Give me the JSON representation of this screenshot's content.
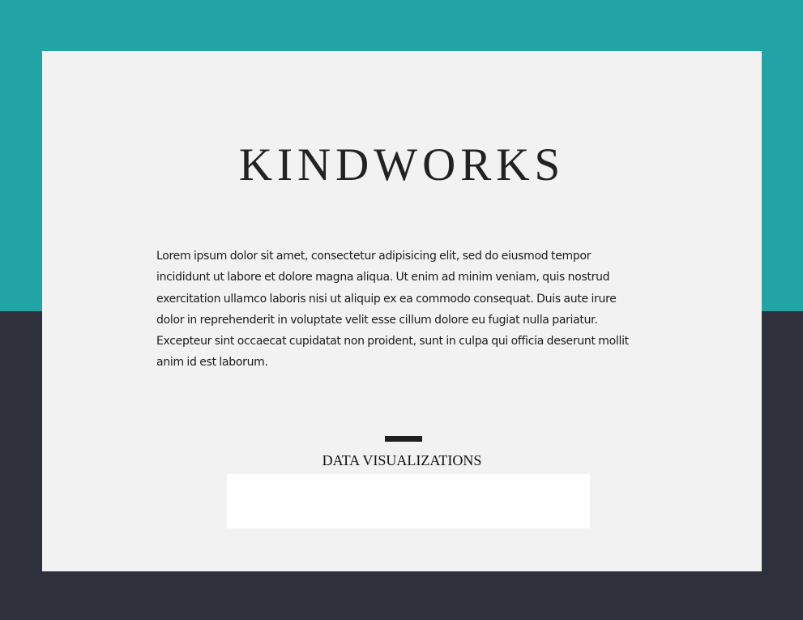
{
  "colors": {
    "top_band": "#22a3a4",
    "bottom_band": "#2e303c",
    "card_background": "#f2f2f2",
    "text": "#222222",
    "viz_area": "#ffffff"
  },
  "header": {
    "title": "KINDWORKS"
  },
  "intro": {
    "text": "Lorem ipsum dolor sit amet, consectetur adipisicing elit, sed do eiusmod tempor incididunt ut labore et dolore magna aliqua. Ut enim ad minim veniam, quis nostrud exercitation ullamco laboris nisi ut aliquip ex ea commodo consequat. Duis aute irure dolor in reprehenderit in voluptate velit esse cillum dolore eu fugiat nulla pariatur. Excepteur sint occaecat cupidatat non proident, sunt in culpa qui officia deserunt mollit anim id est laborum."
  },
  "visualizations": {
    "title": "DATA VISUALIZATIONS"
  }
}
